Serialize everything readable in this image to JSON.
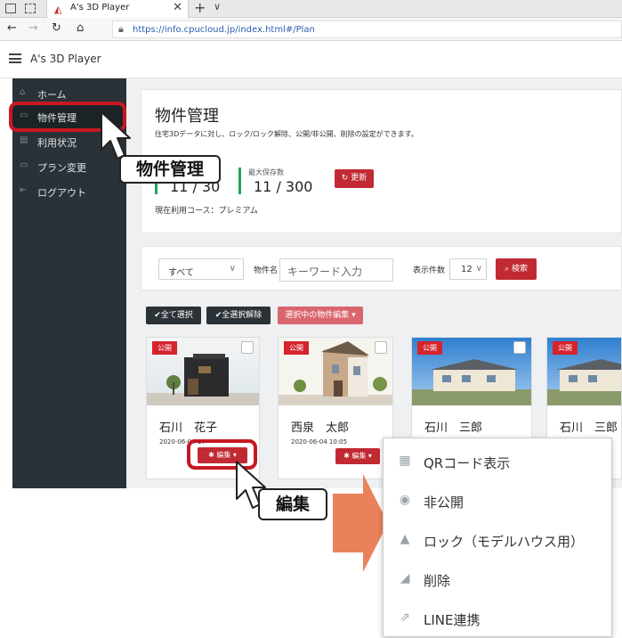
{
  "browser": {
    "tab_title": "A's 3D Player",
    "tab_close": "✕",
    "new_tab": "+",
    "tab_dropdown": "∨",
    "url": "https://info.cpucloud.jp/index.html#/Plan"
  },
  "app": {
    "title": "A's 3D Player"
  },
  "sidebar": {
    "items": [
      {
        "label": "ホーム"
      },
      {
        "label": "物件管理"
      },
      {
        "label": "利用状況"
      },
      {
        "label": "プラン変更"
      },
      {
        "label": "ログアウト"
      }
    ]
  },
  "page": {
    "title": "物件管理",
    "description": "住宅3Dデータに対し、ロック/ロック解除、公開/非公開、削除の設定ができます。",
    "stat1": {
      "value": "11 / 30"
    },
    "stat2": {
      "label": "最大保存数",
      "value": "11 / 300"
    },
    "refresh_label": "更新",
    "course": "現在利用コース：プレミアム"
  },
  "filter": {
    "status_value": "すべて",
    "name_label": "物件名",
    "keyword_placeholder": "キーワード入力",
    "count_label": "表示件数",
    "count_value": "12",
    "search_label": "検索"
  },
  "actions": {
    "select_all": "✔全て選択",
    "deselect_all": "✔全選択解除",
    "bulk_edit": "選択中の物件編集"
  },
  "cards": [
    {
      "badge": "公開",
      "name": "石川　花子",
      "date": "2020-06-04 17",
      "edit": "編集"
    },
    {
      "badge": "公開",
      "name": "西泉　太郎",
      "date": "2020-06-04 10:05",
      "edit": "編集"
    },
    {
      "badge": "公開",
      "name": "石川　三郎"
    },
    {
      "badge": "公開",
      "name": "石川　三郎"
    }
  ],
  "callouts": {
    "menu_label": "物件管理",
    "edit_label": "編集"
  },
  "dropdown": {
    "items": [
      {
        "label": "QRコード表示",
        "icon": "qr-code-icon"
      },
      {
        "label": "非公開",
        "icon": "eye-slash-icon"
      },
      {
        "label": "ロック（モデルハウス用）",
        "icon": "lock-icon"
      },
      {
        "label": "削除",
        "icon": "eraser-icon"
      },
      {
        "label": "LINE連携",
        "icon": "share-icon"
      }
    ]
  },
  "colors": {
    "sidebar_bg": "#2a3238",
    "accent_red": "#c12a32",
    "highlight_red": "#c71822",
    "stat_green": "#1fa55a",
    "arrow_orange": "#e9825a"
  }
}
